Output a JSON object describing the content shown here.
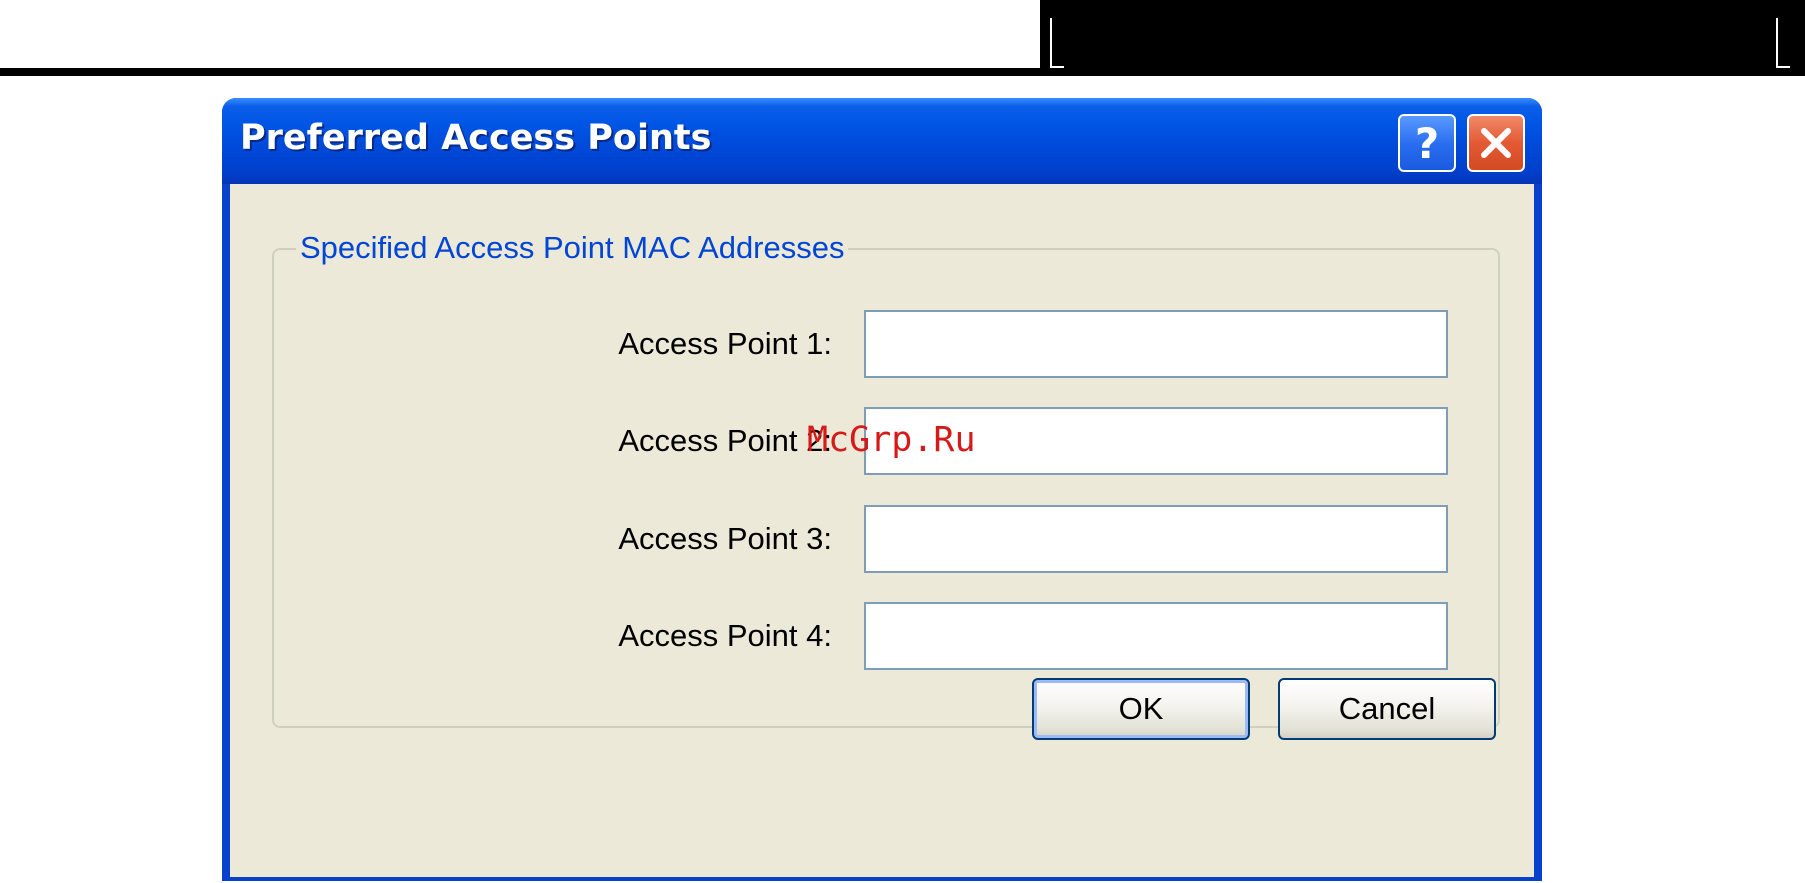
{
  "dialog": {
    "title": "Preferred Access Points",
    "help_button": "?",
    "close_icon": "close-icon"
  },
  "group": {
    "legend": "Specified Access Point MAC Addresses",
    "access_points": [
      {
        "label": "Access Point 1:",
        "value": ""
      },
      {
        "label": "Access Point 2:",
        "value": ""
      },
      {
        "label": "Access Point 3:",
        "value": ""
      },
      {
        "label": "Access Point 4:",
        "value": ""
      }
    ]
  },
  "buttons": {
    "ok": "OK",
    "cancel": "Cancel"
  },
  "watermark": "McGrp.Ru",
  "colors": {
    "title_bar": "#0055e5",
    "client_background": "#ece9d8",
    "group_legend": "#0046d5",
    "close_button": "#e35a34",
    "watermark": "#d61a1a"
  }
}
